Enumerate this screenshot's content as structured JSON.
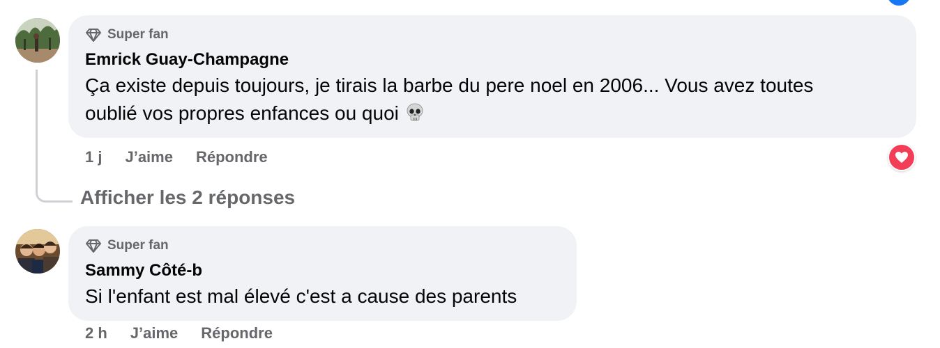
{
  "comments": [
    {
      "badge": "Super fan",
      "author": "Emrick Guay-Champagne",
      "line1": "Ça existe depuis toujours, je tirais la barbe du pere noel en 2006... Vous avez toutes",
      "line2": "oublié vos propres enfances ou quoi",
      "emoji_icon": "skull-icon",
      "time": "1 j",
      "like_label": "J’aime",
      "reply_label": "Répondre",
      "reaction_icon": "heart-reaction-icon"
    },
    {
      "badge": "Super fan",
      "author": "Sammy Côté-b",
      "line1": "Si l'enfant est mal élevé c'est a cause des parents",
      "time": "2 h",
      "like_label": "J’aime",
      "reply_label": "Répondre"
    }
  ],
  "show_replies_label": "Afficher les 2 réponses",
  "colors": {
    "bubble": "#f0f2f5",
    "secondary_text": "#65676b",
    "primary_text": "#050505",
    "heart": "#f33e58",
    "thread_line": "#ced0d4",
    "top_badge": "#1877f2"
  }
}
